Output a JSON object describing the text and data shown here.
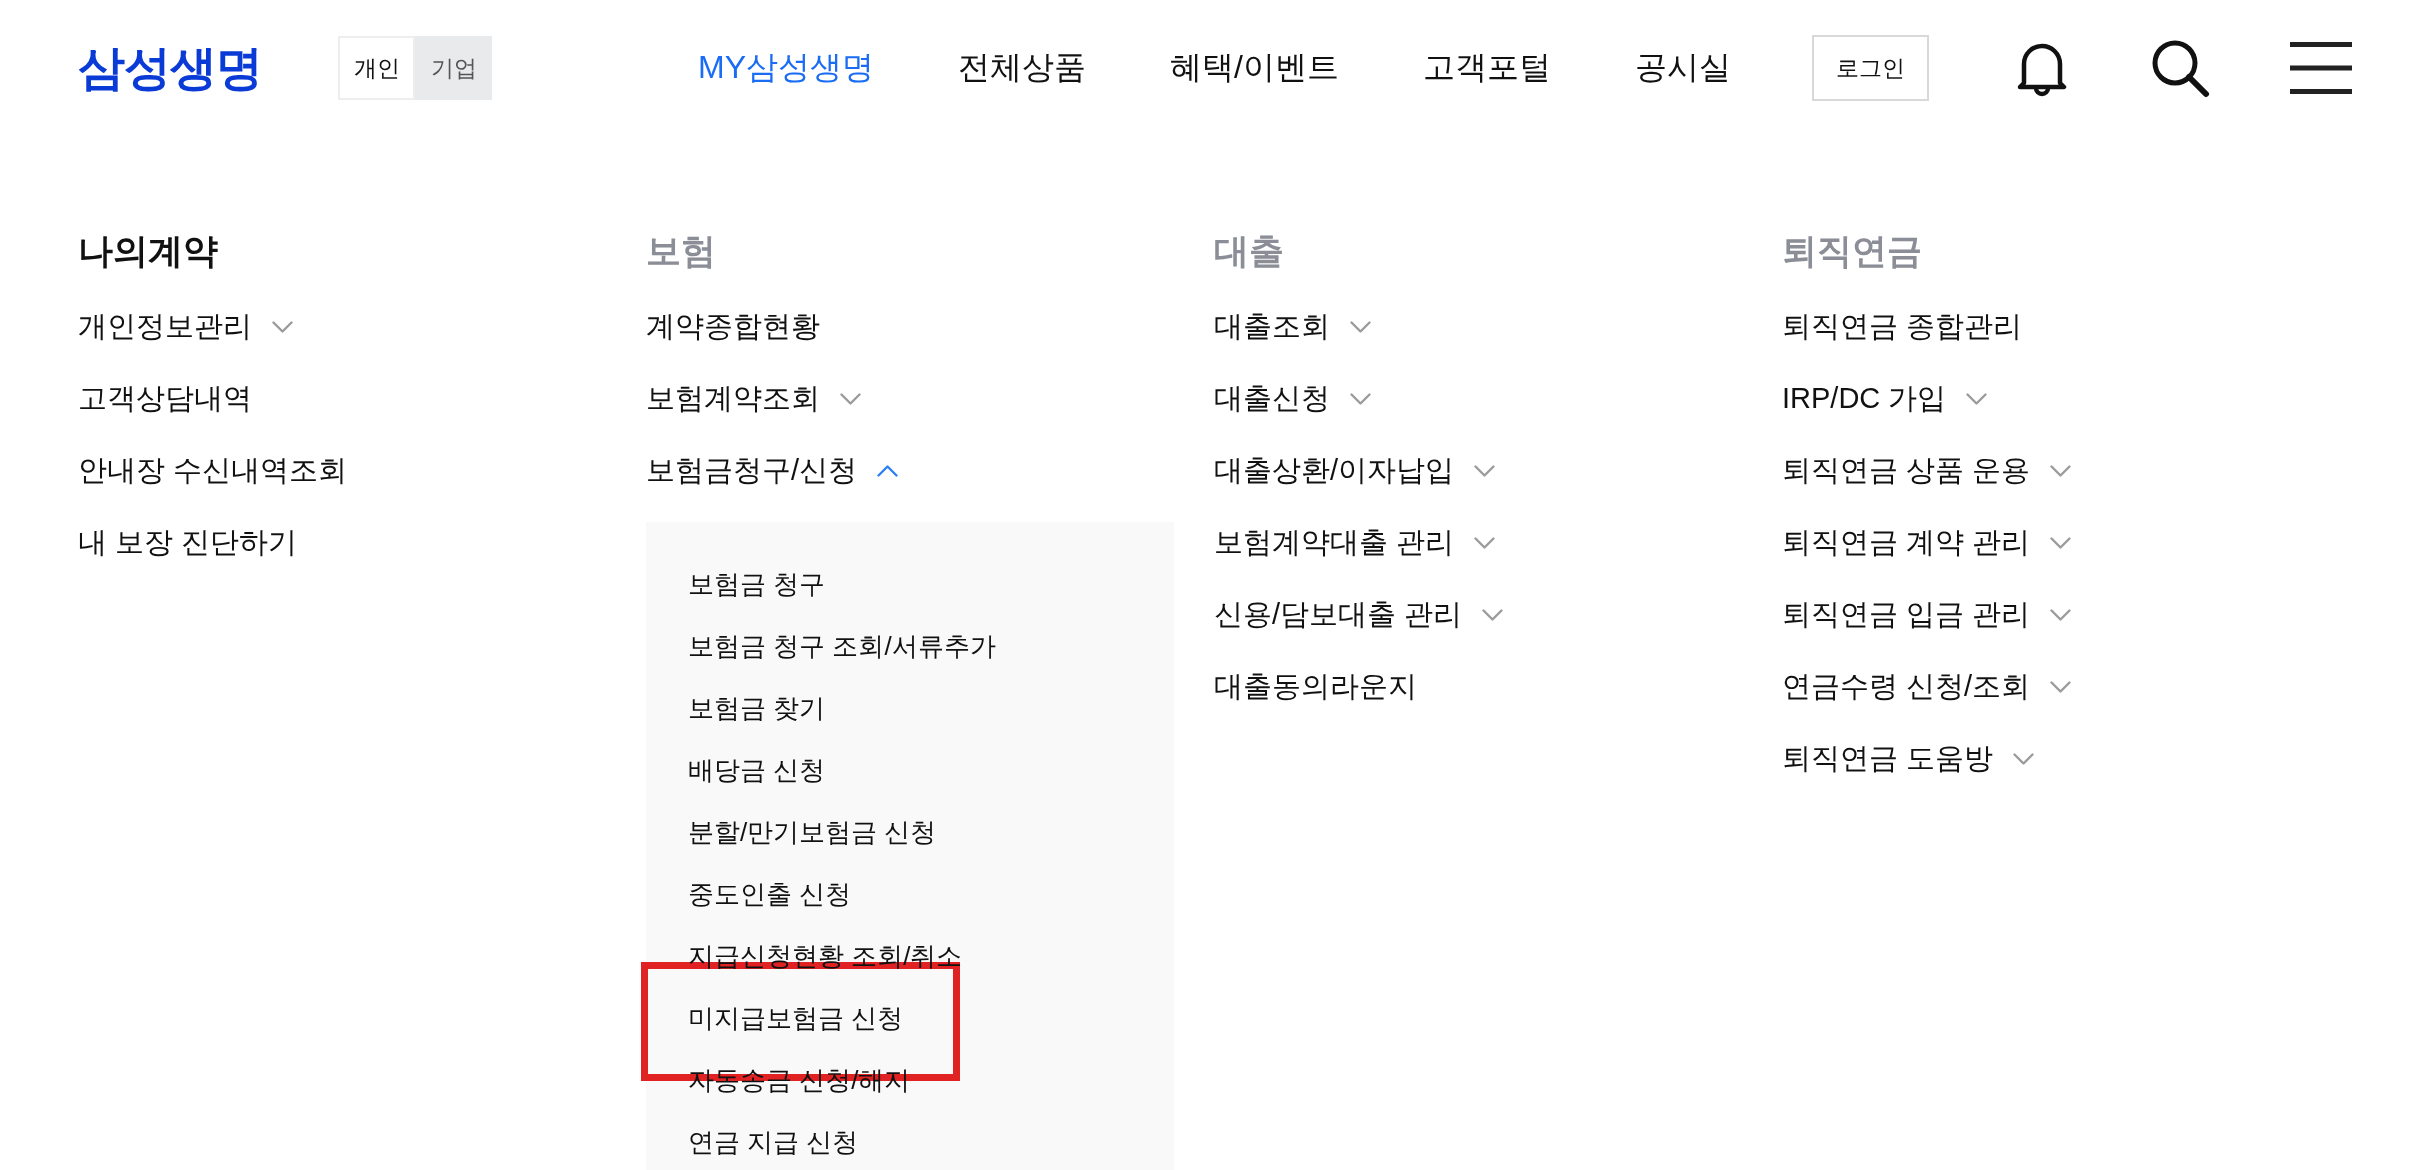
{
  "header": {
    "logo": "삼성생명",
    "audience_toggle": [
      {
        "label": "개인",
        "selected": true
      },
      {
        "label": "기업",
        "selected": false
      }
    ],
    "nav": [
      {
        "label": "MY삼성생명",
        "selected": true
      },
      {
        "label": "전체상품",
        "selected": false
      },
      {
        "label": "혜택/이벤트",
        "selected": false
      },
      {
        "label": "고객포털",
        "selected": false
      },
      {
        "label": "공시실",
        "selected": false
      }
    ],
    "login_button": "로그인"
  },
  "menu_columns": [
    {
      "heading": "나의계약",
      "active": true,
      "items": [
        {
          "label": "개인정보관리",
          "kind": "dropdown",
          "expanded": false
        },
        {
          "label": "고객상담내역",
          "kind": "link"
        },
        {
          "label": "안내장 수신내역조회",
          "kind": "link"
        },
        {
          "label": "내 보장 진단하기",
          "kind": "link"
        }
      ]
    },
    {
      "heading": "보험",
      "active": false,
      "items": [
        {
          "label": "계약종합현황",
          "kind": "link"
        },
        {
          "label": "보험계약조회",
          "kind": "dropdown",
          "expanded": false
        },
        {
          "label": "보험금청구/신청",
          "kind": "dropdown",
          "expanded": true,
          "children": [
            {
              "label": "보험금 청구",
              "highlighted": false
            },
            {
              "label": "보험금 청구 조회/서류추가",
              "highlighted": false
            },
            {
              "label": "보험금 찾기",
              "highlighted": false
            },
            {
              "label": "배당금 신청",
              "highlighted": false
            },
            {
              "label": "분할/만기보험금 신청",
              "highlighted": false
            },
            {
              "label": "중도인출 신청",
              "highlighted": false
            },
            {
              "label": "지급신청현황 조회/취소",
              "highlighted": false
            },
            {
              "label": "미지급보험금 신청",
              "highlighted": true
            },
            {
              "label": "자동송금 신청/해지",
              "highlighted": false
            },
            {
              "label": "연금 지급 신청",
              "highlighted": false
            }
          ]
        }
      ]
    },
    {
      "heading": "대출",
      "active": false,
      "items": [
        {
          "label": "대출조회",
          "kind": "dropdown",
          "expanded": false
        },
        {
          "label": "대출신청",
          "kind": "dropdown",
          "expanded": false
        },
        {
          "label": "대출상환/이자납입",
          "kind": "dropdown",
          "expanded": false
        },
        {
          "label": "보험계약대출 관리",
          "kind": "dropdown",
          "expanded": false
        },
        {
          "label": "신용/담보대출 관리",
          "kind": "dropdown",
          "expanded": false
        },
        {
          "label": "대출동의라운지",
          "kind": "link"
        }
      ]
    },
    {
      "heading": "퇴직연금",
      "active": false,
      "items": [
        {
          "label": "퇴직연금 종합관리",
          "kind": "link"
        },
        {
          "label": "IRP/DC 가입",
          "kind": "dropdown",
          "expanded": false
        },
        {
          "label": "퇴직연금 상품 운용",
          "kind": "dropdown",
          "expanded": false
        },
        {
          "label": "퇴직연금 계약 관리",
          "kind": "dropdown",
          "expanded": false
        },
        {
          "label": "퇴직연금 입금 관리",
          "kind": "dropdown",
          "expanded": false
        },
        {
          "label": "연금수령 신청/조회",
          "kind": "dropdown",
          "expanded": false
        },
        {
          "label": "퇴직연금 도움방",
          "kind": "dropdown",
          "expanded": false
        }
      ]
    }
  ]
}
